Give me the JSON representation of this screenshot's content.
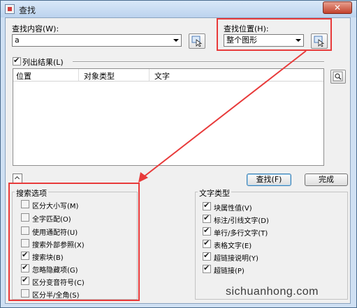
{
  "window": {
    "title": "查找",
    "close_glyph": "✕"
  },
  "find_what": {
    "label": "查找内容(W):",
    "value": "a"
  },
  "find_where": {
    "label": "查找位置(H):",
    "selected": "整个图形"
  },
  "list_results": {
    "label": "列出结果(L)",
    "checked": true,
    "columns": [
      "位置",
      "对象类型",
      "文字"
    ]
  },
  "buttons": {
    "find": "查找(F)",
    "done": "完成"
  },
  "search_options": {
    "title": "搜索选项",
    "items": [
      {
        "label": "区分大小写(M)",
        "checked": false
      },
      {
        "label": "全字匹配(O)",
        "checked": false
      },
      {
        "label": "使用通配符(U)",
        "checked": false
      },
      {
        "label": "搜索外部参照(X)",
        "checked": false
      },
      {
        "label": "搜索块(B)",
        "checked": true
      },
      {
        "label": "忽略隐藏项(G)",
        "checked": true
      },
      {
        "label": "区分变音符号(C)",
        "checked": true
      },
      {
        "label": "区分半/全角(S)",
        "checked": false
      }
    ]
  },
  "text_types": {
    "title": "文字类型",
    "items": [
      {
        "label": "块属性值(V)",
        "checked": true
      },
      {
        "label": "标注/引线文字(D)",
        "checked": true
      },
      {
        "label": "单行/多行文字(T)",
        "checked": true
      },
      {
        "label": "表格文字(E)",
        "checked": true
      },
      {
        "label": "超链接说明(Y)",
        "checked": true
      },
      {
        "label": "超链接(P)",
        "checked": true
      }
    ]
  },
  "watermark": "sichuanhong.com",
  "colors": {
    "highlight": "#e83a3a",
    "title_bar": "#bcd3ee"
  }
}
